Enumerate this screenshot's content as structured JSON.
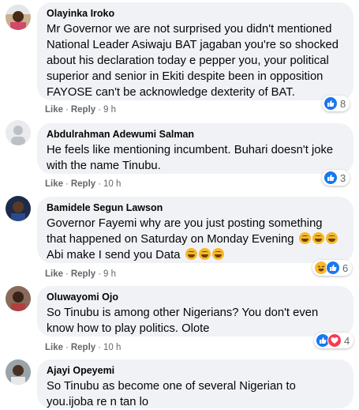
{
  "comments": [
    {
      "author": "Olayinka Iroko",
      "text": "Mr Governor we are not surprised you didn't mentioned National Leader Asiwaju BAT jagaban you're so shocked about his declaration today e pepper you, your political superior and senior in Ekiti despite been in opposition FAYOSE can't be acknowledge dexterity of BAT.",
      "like_label": "Like",
      "reply_label": "Reply",
      "time": "9 h",
      "reaction_count": "8"
    },
    {
      "author": "Abdulrahman Adewumi Salman",
      "text": "He feels like mentioning incumbent. Buhari doesn't joke with the name Tinubu.",
      "like_label": "Like",
      "reply_label": "Reply",
      "time": "10 h",
      "reaction_count": "3"
    },
    {
      "author": "Bamidele Segun Lawson",
      "text": "Governor Fayemi why are you just posting something that happened on Saturday on Monday Evening",
      "text2": "Abi make I send you Data",
      "like_label": "Like",
      "reply_label": "Reply",
      "time": "9 h",
      "reaction_count": "6"
    },
    {
      "author": "Oluwayomi Ojo",
      "text": "So Tinubu is among other Nigerians? You don't even know how to play politics. Olote",
      "like_label": "Like",
      "reply_label": "Reply",
      "time": "10 h",
      "reaction_count": "4"
    },
    {
      "author": "Ajayi Opeyemi",
      "text": "So Tinubu as become one of several Nigerian to you.ijoba re n tan lo"
    }
  ],
  "separator": "·",
  "colors": {
    "bubble": "#f0f2f5",
    "meta": "#65676b",
    "like": "#1877f2",
    "haha": "#f7b928",
    "love": "#f33e58"
  }
}
